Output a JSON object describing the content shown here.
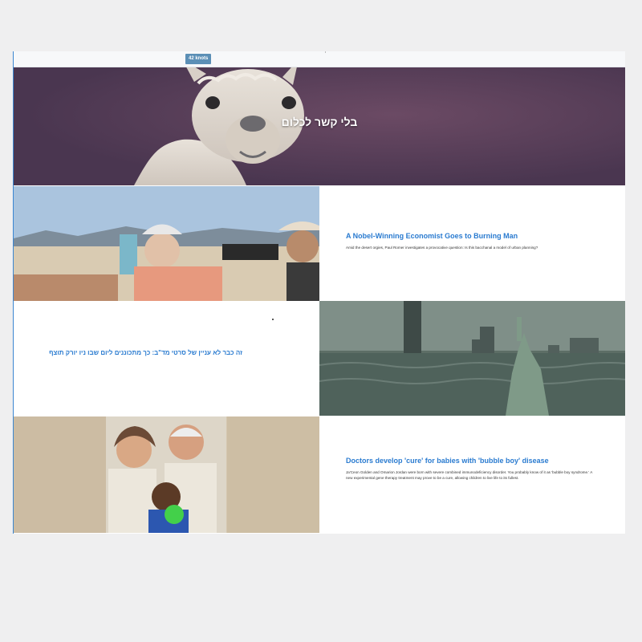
{
  "topbar": {
    "badge": "42 knots"
  },
  "hero": {
    "title": "בלי קשר לכלום"
  },
  "articles": [
    {
      "title": "A Nobel-Winning Economist Goes to Burning Man",
      "description": "Amid the desert orgies, Paul Romer investigates a provocative question: Is this bacchanal a model of urban planning?"
    },
    {
      "title": "זה כבר לא עניין של סרטי מד\"ב: כך מתכוננים ליום שבו ניו יורק תוצף",
      "description": ""
    },
    {
      "title": "Doctors develop 'cure' for babies with 'bubble boy' disease",
      "description": "Ja'Ceon Golden and Omarion Jordan were born with severe combined immunodeficiency disorder. You probably know of it as 'bubble boy syndrome.' A new experimental gene therapy treatment may prove to be a cure, allowing children to live life to its fullest."
    }
  ],
  "colors": {
    "link": "#2a7bd0",
    "badge": "#5b8fb6",
    "accent_border": "#3b86d1"
  }
}
